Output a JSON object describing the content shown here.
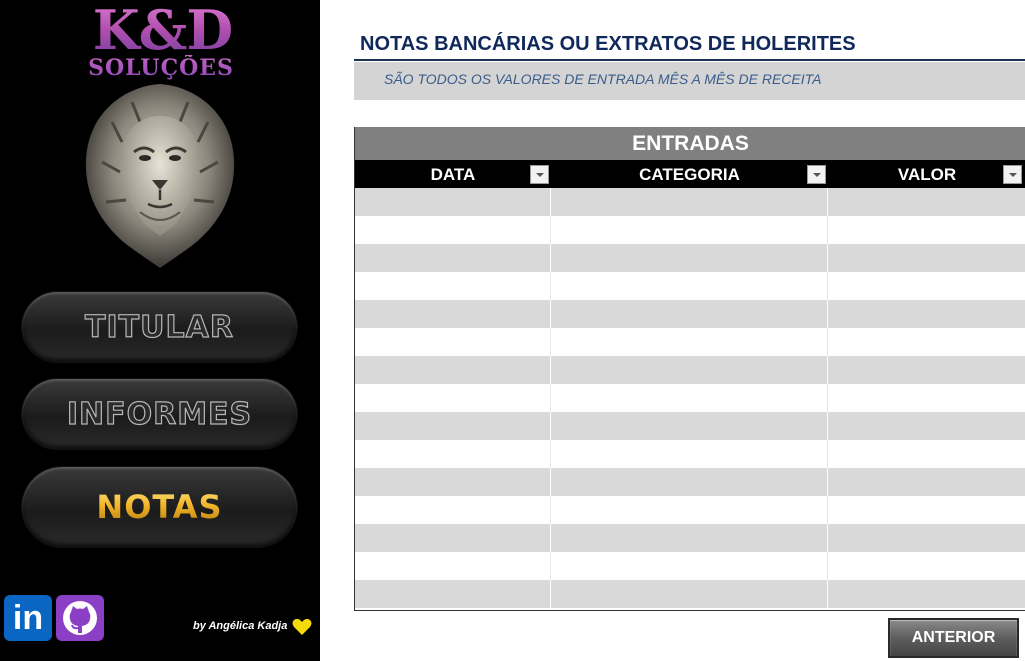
{
  "sidebar": {
    "logo_main": "K&D",
    "logo_sub": "SOLUÇÕES",
    "nav": {
      "titular": "TITULAR",
      "informes": "INFORMES",
      "notas": "NOTAS"
    },
    "linkedin_label": "in",
    "credit": "by Angélica Kadja",
    "icons": [
      "lion-logo-icon",
      "linkedin-icon",
      "github-icon",
      "yellow-heart-icon"
    ]
  },
  "main": {
    "title": "NOTAS BANCÁRIAS OU EXTRATOS DE HOLERITES",
    "subtitle": "SÃO TODOS OS VALORES DE ENTRADA MÊS A MÊS DE RECEITA",
    "table": {
      "title": "ENTRADAS",
      "columns": [
        "DATA",
        "CATEGORIA",
        "VALOR"
      ],
      "rows": [
        [
          "",
          "",
          ""
        ],
        [
          "",
          "",
          ""
        ],
        [
          "",
          "",
          ""
        ],
        [
          "",
          "",
          ""
        ],
        [
          "",
          "",
          ""
        ],
        [
          "",
          "",
          ""
        ],
        [
          "",
          "",
          ""
        ],
        [
          "",
          "",
          ""
        ],
        [
          "",
          "",
          ""
        ],
        [
          "",
          "",
          ""
        ],
        [
          "",
          "",
          ""
        ],
        [
          "",
          "",
          ""
        ],
        [
          "",
          "",
          ""
        ],
        [
          "",
          "",
          ""
        ],
        [
          "",
          "",
          ""
        ]
      ]
    },
    "back_button": "ANTERIOR"
  },
  "colors": {
    "sidebar_bg": "#000000",
    "title_color": "#10285a",
    "subtitle_color": "#3a5c8a",
    "table_title_bg": "#808080",
    "header_bg": "#000000",
    "band_gray": "#d9d9d9",
    "gold": "#f0b52a",
    "logo_purple": "#b04fae"
  }
}
